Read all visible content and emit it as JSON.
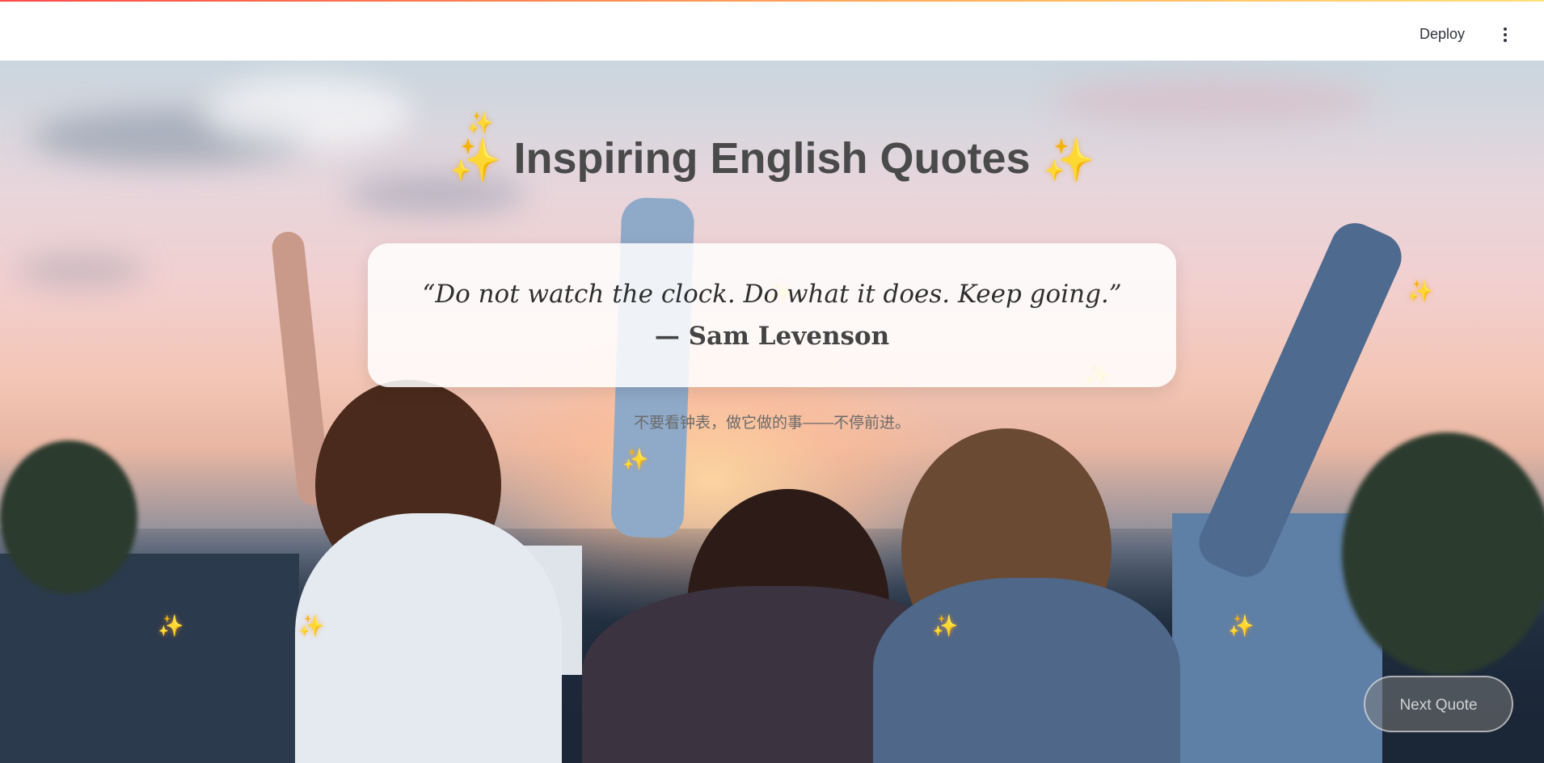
{
  "header": {
    "deploy_label": "Deploy",
    "menu_icon": "more-vertical-icon",
    "accent_gradient": [
      "#ff4b4b",
      "#ffe17a"
    ]
  },
  "title": {
    "text": "Inspiring English Quotes",
    "left_icon": "sparkles-icon",
    "right_icon": "sparkles-icon"
  },
  "quote": {
    "text": "“Do not watch the clock. Do what it does. Keep going.”",
    "author": "— Sam Levenson",
    "translation": "不要看钟表，做它做的事——不停前进。"
  },
  "next_button": {
    "label": "Next Quote"
  },
  "sparkle_glyph": "✨",
  "colors": {
    "title": "#4a4a4a",
    "sparkle": "#ffb020",
    "card_bg": "#ffffff"
  }
}
